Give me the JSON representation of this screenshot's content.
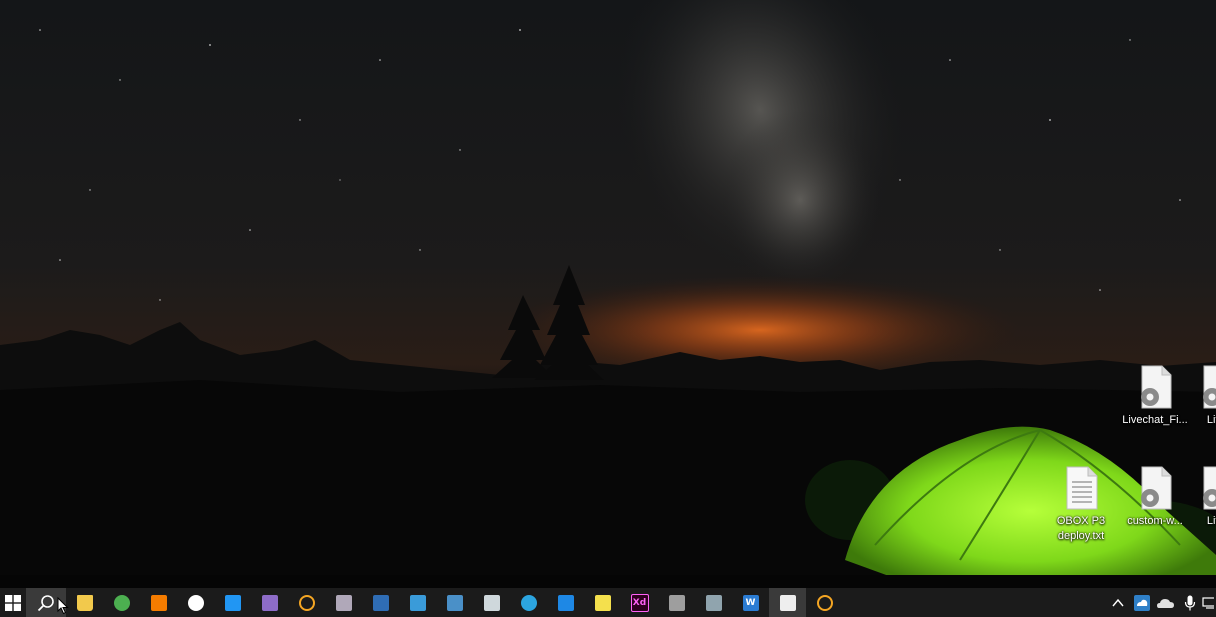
{
  "desktop": {
    "icons": [
      {
        "label": "Livechat_Fi...",
        "icon": "settings-file-icon"
      },
      {
        "label": "Live",
        "icon": "settings-file-icon"
      },
      {
        "label": "OBOX P3\ndeploy.txt",
        "icon": "text-file-icon"
      },
      {
        "label": "custom-w...",
        "icon": "settings-file-icon"
      },
      {
        "label": "Live",
        "icon": "settings-file-icon"
      }
    ]
  },
  "taskbar": {
    "start": {
      "icon": "windows-logo-icon"
    },
    "search": {
      "icon": "search-icon"
    },
    "apps": [
      {
        "icon": "file-explorer-icon",
        "color": "#f2c94c"
      },
      {
        "icon": "chrome-icon",
        "color": "#4caf50"
      },
      {
        "icon": "orange-app-icon",
        "color": "#f57c00"
      },
      {
        "icon": "circle-app-icon",
        "color": "#ffffff"
      },
      {
        "icon": "vscode-icon",
        "color": "#2196f3"
      },
      {
        "icon": "visual-studio-icon",
        "color": "#8e6cc8"
      },
      {
        "icon": "sync-app-icon",
        "color": "#f5a623"
      },
      {
        "icon": "chat-app-icon",
        "color": "#b0a8b9"
      },
      {
        "icon": "rocket-app-icon",
        "color": "#2f6db5"
      },
      {
        "icon": "tools-app-icon",
        "color": "#3a9bd9"
      },
      {
        "icon": "network-app-icon",
        "color": "#4a90c8"
      },
      {
        "icon": "remote-desktop-icon",
        "color": "#cfd8dc"
      },
      {
        "icon": "telegram-icon",
        "color": "#2ca5e0"
      },
      {
        "icon": "mail-app-icon",
        "color": "#1e88e5"
      },
      {
        "icon": "sticky-notes-icon",
        "color": "#f4e04d"
      },
      {
        "icon": "adobe-xd-icon",
        "color": "#470137"
      },
      {
        "icon": "palette-app-icon",
        "color": "#9e9e9e"
      },
      {
        "icon": "paint-app-icon",
        "color": "#90a4ae"
      },
      {
        "icon": "word-app-icon",
        "color": "#2b7cd3"
      },
      {
        "icon": "message-app-icon",
        "color": "#eeeeee"
      },
      {
        "icon": "sync-app-icon-2",
        "color": "#f5a623"
      }
    ],
    "tray": [
      {
        "icon": "chevron-up-icon"
      },
      {
        "icon": "cloud-sync-icon"
      },
      {
        "icon": "onedrive-icon"
      },
      {
        "icon": "microphone-icon"
      },
      {
        "icon": "network-icon"
      }
    ]
  }
}
